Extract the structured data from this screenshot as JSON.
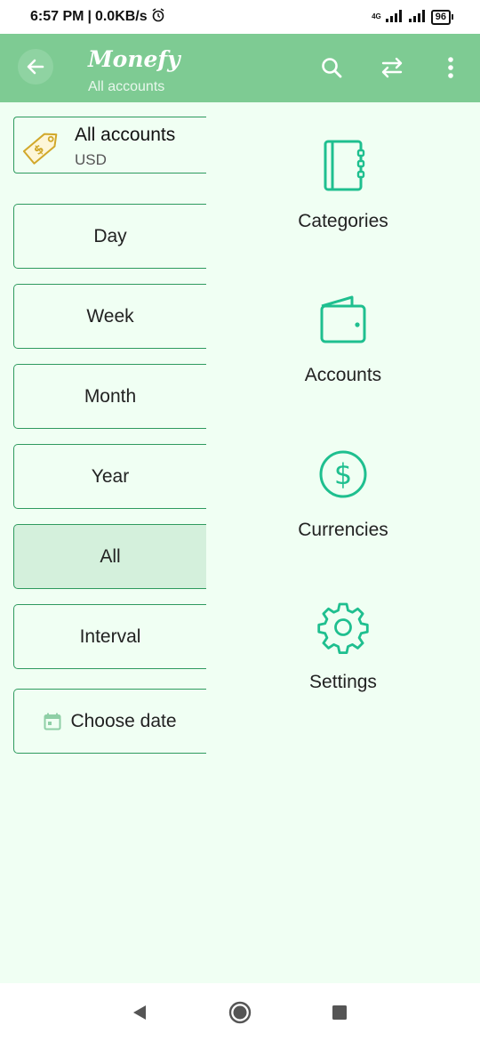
{
  "status_bar": {
    "time": "6:57 PM",
    "speed": "0.0KB/s",
    "network": "4G",
    "battery": "96"
  },
  "app_bar": {
    "brand": "Monefy",
    "subtitle": "All accounts"
  },
  "account": {
    "name": "All accounts",
    "currency": "USD"
  },
  "periods": [
    {
      "label": "Day",
      "selected": false
    },
    {
      "label": "Week",
      "selected": false
    },
    {
      "label": "Month",
      "selected": false
    },
    {
      "label": "Year",
      "selected": false
    },
    {
      "label": "All",
      "selected": true
    },
    {
      "label": "Interval",
      "selected": false
    }
  ],
  "choose_date_label": "Choose date",
  "menu": [
    {
      "label": "Categories",
      "icon": "notebook-icon"
    },
    {
      "label": "Accounts",
      "icon": "wallet-icon"
    },
    {
      "label": "Currencies",
      "icon": "dollar-circle-icon"
    },
    {
      "label": "Settings",
      "icon": "gear-icon"
    }
  ],
  "colors": {
    "accent": "#7ecb93",
    "icon_teal": "#1fbf8f",
    "border_green": "#2e9a5e",
    "selected_bg": "#d4f0dc",
    "background": "#f0fff3"
  }
}
